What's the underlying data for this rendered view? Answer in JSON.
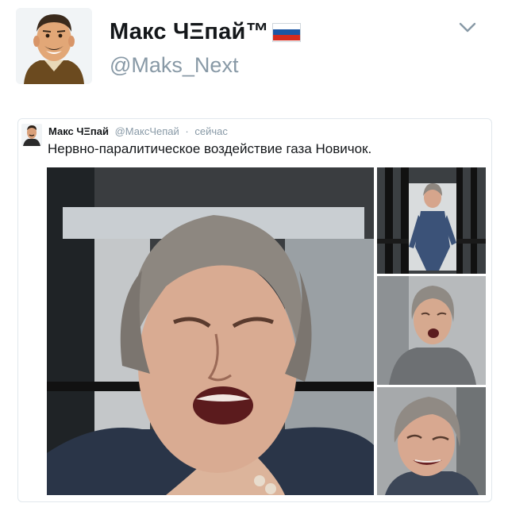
{
  "profile": {
    "display_name": "Макс ЧΞпай™",
    "handle": "@Maks_Next",
    "avatar_icon": "cartoon-man-avatar-icon",
    "flag_icon": "russia-flag-icon",
    "flag_colors": [
      "#ffffff",
      "#1c57a5",
      "#d52b1e"
    ]
  },
  "quoted_tweet": {
    "name": "Макс ЧΞпай",
    "handle": "@МаксЧепай",
    "separator": "·",
    "time": "сейчас",
    "text": "Нервно-паралитическое воздействие газа Новичок.",
    "media": {
      "main_image": "woman-grimacing-photo",
      "thumbnails": [
        "woman-walking-photo",
        "woman-grimacing-photo",
        "woman-grimacing-photo"
      ]
    }
  },
  "colors": {
    "text_primary": "#14171a",
    "text_secondary": "#8899a6",
    "border": "#e1e8ed"
  }
}
